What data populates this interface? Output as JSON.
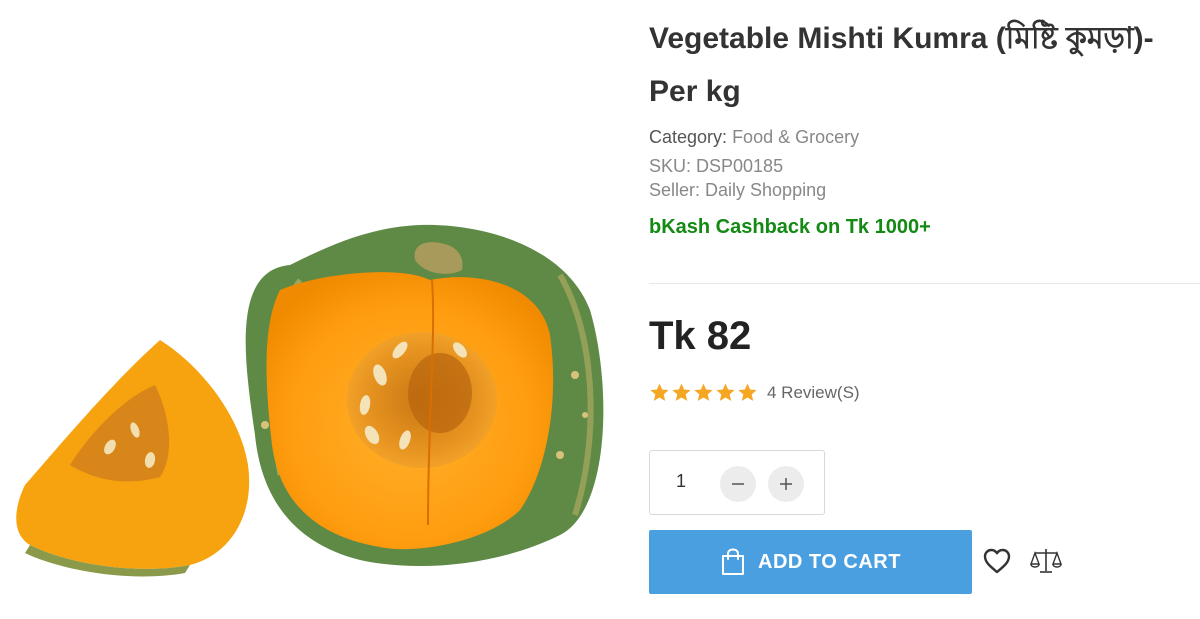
{
  "product": {
    "title_line1": "Vegetable Mishti Kumra (মিষ্টি কুমড়া)-",
    "title_line2": "Per kg",
    "category_label": "Category:",
    "category_value": "Food & Grocery",
    "sku": "SKU: DSP00185",
    "seller": "Seller: Daily Shopping",
    "promo": "bKash Cashback on Tk 1000+",
    "price": "Tk 82",
    "rating_stars": 5,
    "reviews": "4 Review(S)"
  },
  "quantity": {
    "value": "1"
  },
  "actions": {
    "add_to_cart": "ADD TO CART"
  },
  "colors": {
    "accent": "#4a9fe0",
    "promo_green": "#138a13",
    "star": "#f5a623"
  },
  "icons": {
    "cart": "shopping-bag-icon",
    "wishlist": "heart-icon",
    "compare": "scale-icon",
    "minus": "minus-icon",
    "plus": "plus-icon"
  }
}
